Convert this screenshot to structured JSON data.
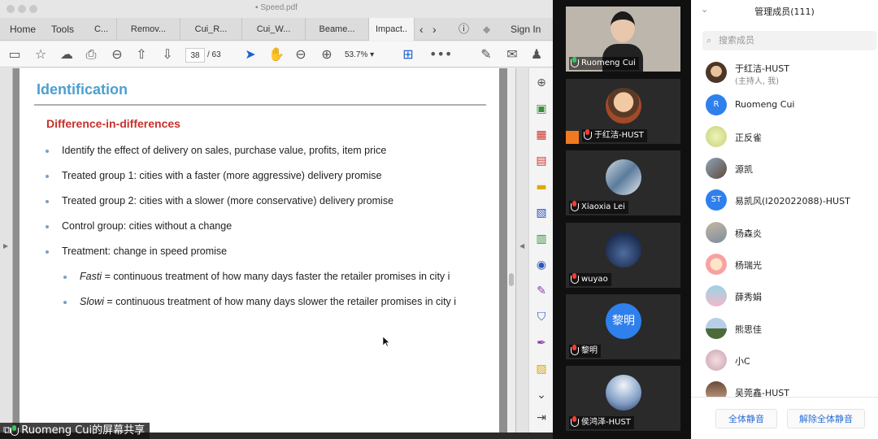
{
  "pdf_window": {
    "title": "Speed.pdf",
    "nav": {
      "home": "Home",
      "tools": "Tools"
    },
    "tabs": [
      "C...",
      "Remov...",
      "Cui_R...",
      "Cui_W...",
      "Beame...",
      "Impact.."
    ],
    "sign_in": "Sign In",
    "page_current": "38",
    "page_total": "/ 63",
    "zoom": "53.7%",
    "more": "•••"
  },
  "slide": {
    "heading": "Identification",
    "subheading": "Difference-in-differences",
    "bullets": [
      "Identify the effect of delivery on sales, purchase value, profits, item price",
      "Treated group 1: cities with a faster (more aggressive) delivery promise",
      "Treated group 2: cities with a slower (more conservative) delivery promise",
      "Control group: cities without a change",
      "Treatment: change in speed promise"
    ],
    "sub_bullets": [
      {
        "term": "Fasti",
        "text": " = continuous treatment of how many days faster the retailer promises in city i"
      },
      {
        "term": "Slowi",
        "text": " = continuous treatment of how many days slower the retailer promises in city i"
      }
    ]
  },
  "share_label": "Ruomeng Cui的屏幕共享",
  "video_tiles": [
    {
      "name": "Ruomeng Cui",
      "mic": "on"
    },
    {
      "name": "于红洁-HUST",
      "mic": "muted"
    },
    {
      "name": "Xiaoxia Lei",
      "mic": "muted"
    },
    {
      "name": "wuyao",
      "mic": "muted"
    },
    {
      "name": "黎明",
      "mic": "muted",
      "avatar_text": "黎明"
    },
    {
      "name": "侯鸿泽-HUST",
      "mic": "muted"
    }
  ],
  "member_panel": {
    "title": "管理成员(111)",
    "search_placeholder": "搜索成员",
    "members": [
      {
        "name": "于红洁-HUST",
        "sub": "(主持人, 我)"
      },
      {
        "name": "Ruomeng Cui",
        "initials": "R"
      },
      {
        "name": "正反雀"
      },
      {
        "name": "源凯"
      },
      {
        "name": "易凯风(I202022088)-HUST",
        "initials": "ST"
      },
      {
        "name": "杨森炎"
      },
      {
        "name": "杨瑞光"
      },
      {
        "name": "薛秀娟"
      },
      {
        "name": "熊思佳"
      },
      {
        "name": "小C"
      },
      {
        "name": "吴莞鑫-HUST"
      }
    ],
    "mute_all": "全体静音",
    "unmute_all": "解除全体静音"
  },
  "colors": {
    "heading": "#4c9fd0",
    "subheading": "#c8312b",
    "accent_blue": "#2a6fd6"
  }
}
